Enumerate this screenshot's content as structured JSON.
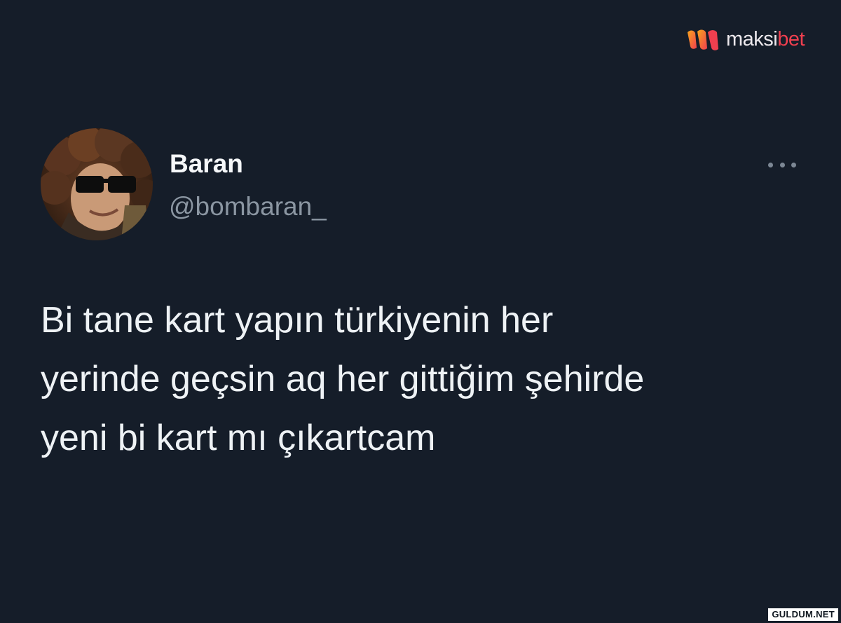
{
  "brand": {
    "part1": "maksi",
    "part2": "bet",
    "accent_color": "#ef3f4f",
    "icon": "maksibet-logo-icon"
  },
  "tweet": {
    "author_name": "Baran",
    "author_handle": "@bombaran_",
    "avatar_icon": "profile-avatar",
    "more_icon": "more-options-icon",
    "text_lines": [
      "Bi tane kart yapın türkiyenin her",
      "yerinde geçsin aq her gittiğim şehirde",
      "yeni bi kart mı çıkartcam"
    ]
  },
  "watermark": {
    "text": "GULDUM.NET"
  },
  "colors": {
    "background": "#151d29",
    "name": "#f5f7f9",
    "handle": "#8b96a2",
    "text": "#eef2f5"
  }
}
